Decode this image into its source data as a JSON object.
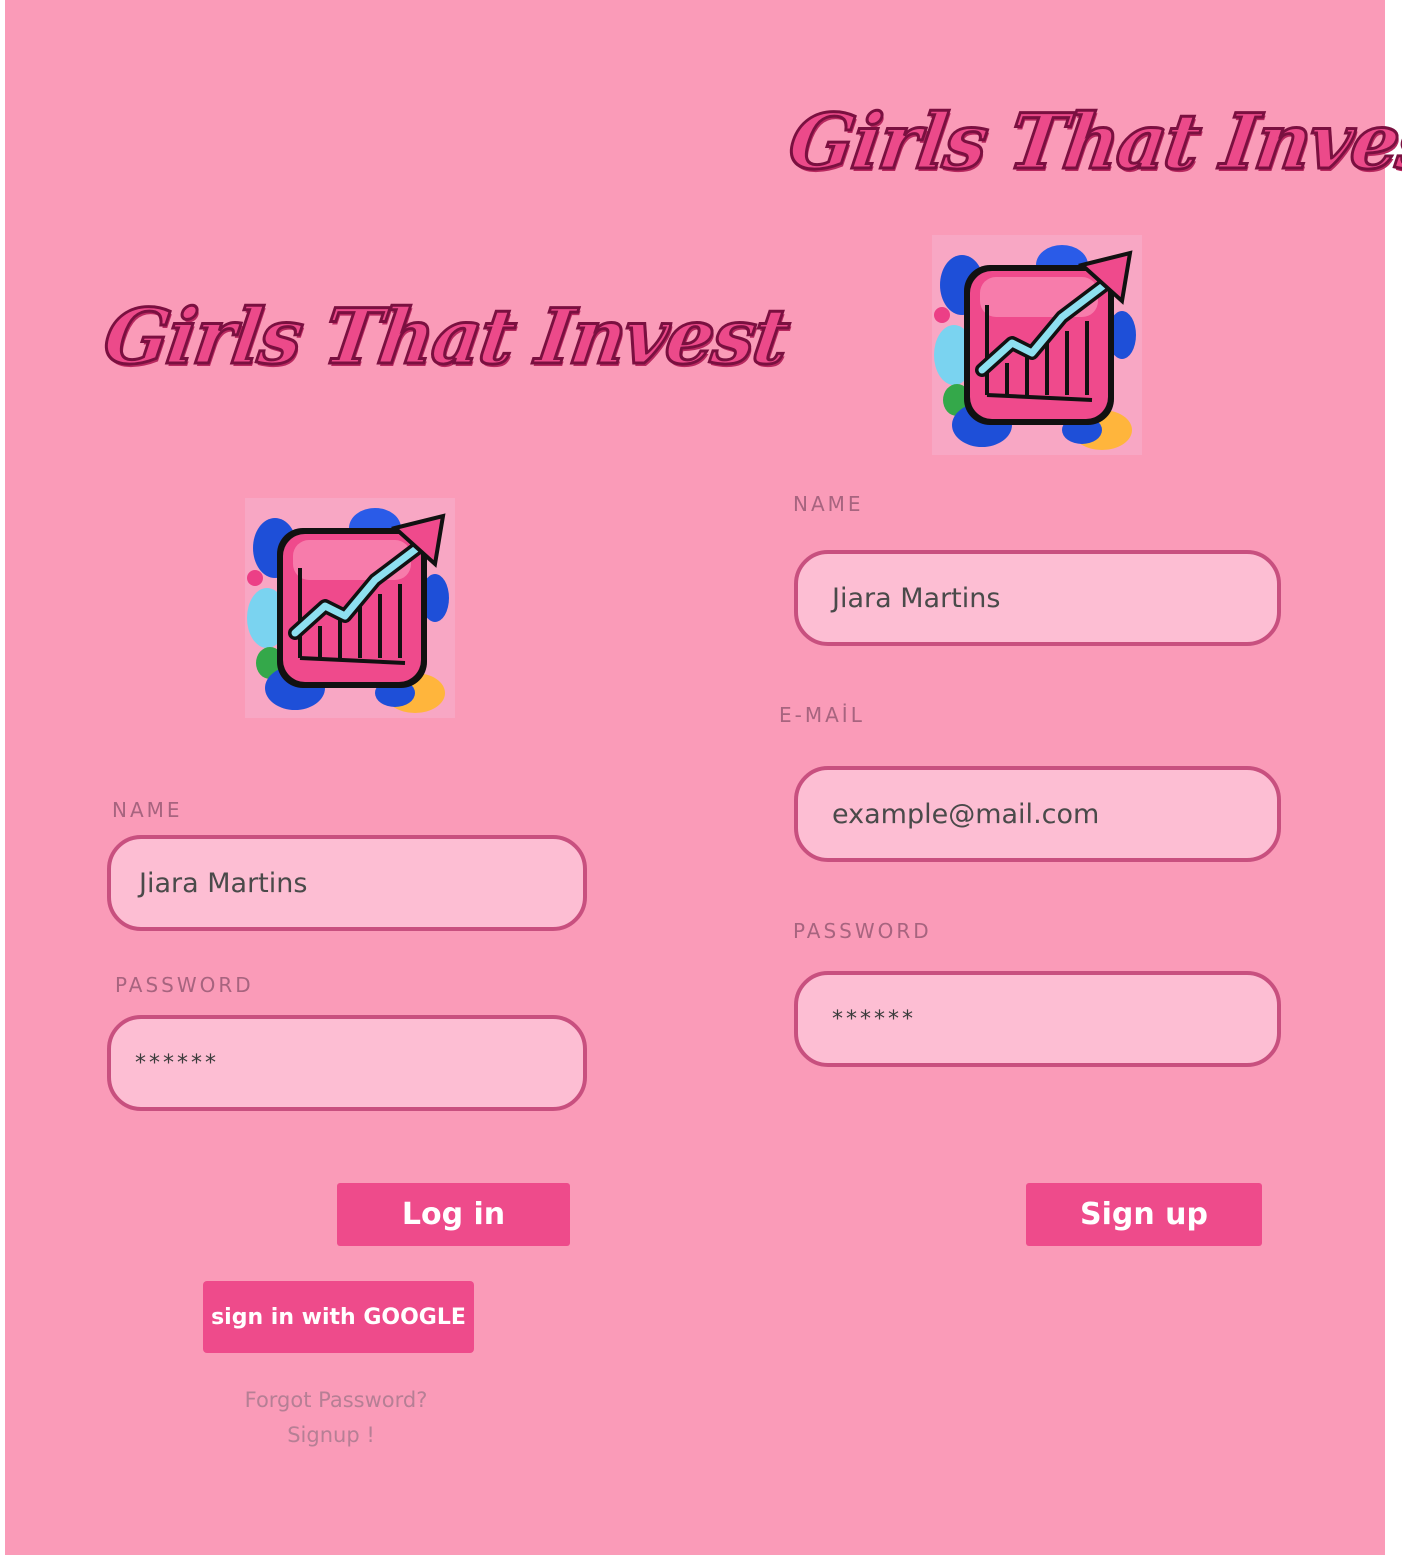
{
  "brand": {
    "title": "Girls That Invest",
    "colors": {
      "background": "#fa9bb8",
      "field_fill": "#fdbed3",
      "field_border": "#c8507f",
      "button": "#ee4b8b",
      "label": "#a7647f"
    },
    "icon": "growth-chart-logo-icon"
  },
  "login": {
    "name_label": "NAME",
    "name_value": "Jiara Martins",
    "password_label": "PASSWORD",
    "password_value": "******",
    "login_button": "Log in",
    "google_button": "sign in with GOOGLE",
    "forgot_link": "Forgot Password?",
    "signup_link": "Signup !"
  },
  "signup": {
    "name_label": "NAME",
    "name_value": "Jiara Martins",
    "email_label": "E-MAİL",
    "email_value": "example@mail.com",
    "password_label": "PASSWORD",
    "password_value": "******",
    "signup_button": "Sign up"
  }
}
